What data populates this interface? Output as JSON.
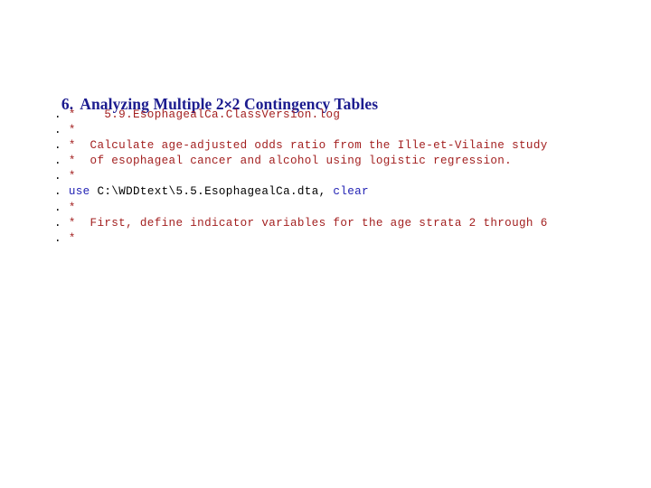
{
  "slide": {
    "background_color": "#ffffff",
    "title": {
      "number": "6.",
      "text_before": "Analyzing Multiple 2",
      "times_symbol": "×",
      "text_after": "2 Contingency Tables",
      "full_text": "6.  Analyzing Multiple 2×2 Contingency Tables",
      "color": "#1c1c8f"
    },
    "code_colors": {
      "prompt": "#000000",
      "comment": "#a32020",
      "keyword": "#2222b4",
      "plain": "#000000"
    },
    "log": {
      "prompt": ".",
      "lines": [
        {
          "index": 1,
          "prompt": ".",
          "segments": [
            {
              "kind": "comment",
              "text": " *    5.9.EsophagealCa.ClassVersion.log"
            }
          ]
        },
        {
          "index": 2,
          "prompt": ".",
          "segments": [
            {
              "kind": "comment",
              "text": " *"
            }
          ]
        },
        {
          "index": 3,
          "prompt": ".",
          "segments": [
            {
              "kind": "comment",
              "text": " *  Calculate age-adjusted odds ratio from the Ille-et-Vilaine study"
            }
          ]
        },
        {
          "index": 4,
          "prompt": ".",
          "segments": [
            {
              "kind": "comment",
              "text": " *  of esophageal cancer and alcohol using logistic regression."
            }
          ]
        },
        {
          "index": 5,
          "prompt": ".",
          "segments": [
            {
              "kind": "comment",
              "text": " *"
            }
          ]
        },
        {
          "index": 6,
          "prompt": ".",
          "segments": [
            {
              "kind": "keyword",
              "text": " use"
            },
            {
              "kind": "plain",
              "text": " C:\\WDDtext\\5.5.EsophagealCa.dta,"
            },
            {
              "kind": "keyword",
              "text": " clear"
            }
          ]
        },
        {
          "index": 7,
          "prompt": ".",
          "segments": [
            {
              "kind": "comment",
              "text": " *"
            }
          ]
        },
        {
          "index": 8,
          "prompt": ".",
          "segments": [
            {
              "kind": "comment",
              "text": " *  First, define indicator variables for the age strata 2 through 6"
            }
          ]
        },
        {
          "index": 9,
          "prompt": ".",
          "segments": [
            {
              "kind": "comment",
              "text": " *"
            }
          ]
        }
      ]
    }
  }
}
